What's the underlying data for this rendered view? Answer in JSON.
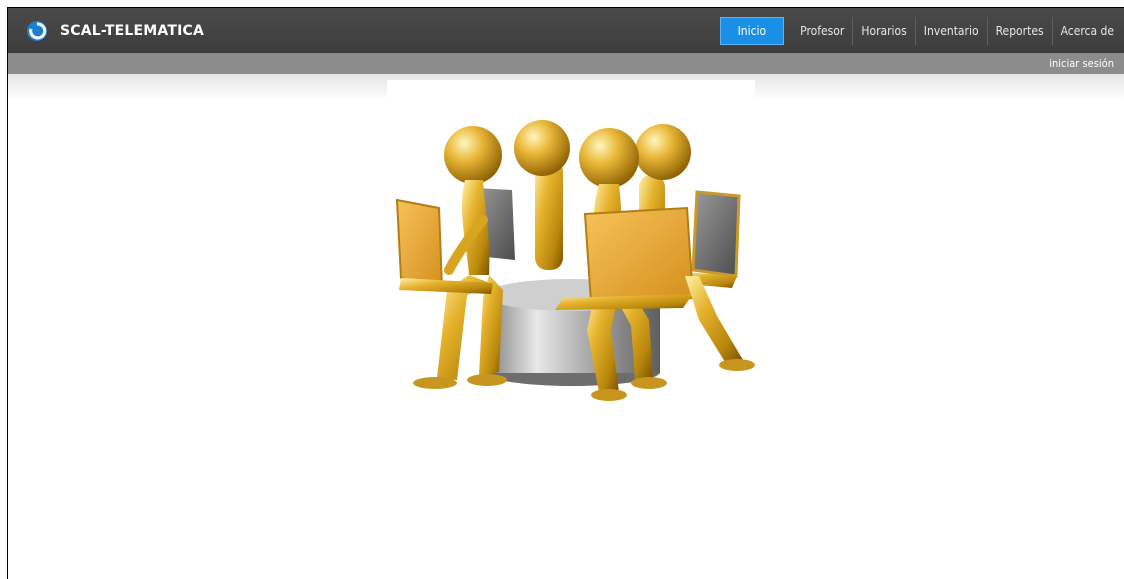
{
  "app": {
    "brand": "SCAL-TELEMATICA"
  },
  "nav": {
    "items": [
      {
        "label": "Inicio",
        "active": true
      },
      {
        "label": "Profesor"
      },
      {
        "label": "Horarios"
      },
      {
        "label": "Inventario"
      },
      {
        "label": "Reportes"
      },
      {
        "label": "Acerca de"
      }
    ]
  },
  "subbar": {
    "login_label": "iniciar sesión"
  },
  "colors": {
    "topbar": "#444444",
    "subbar": "#8c8c8c",
    "active_tab": "#1a8fe8",
    "figure_gold": "#d9a521",
    "cylinder_silver": "#b8b8b8"
  },
  "hero": {
    "icon": "team-computers-illustration"
  }
}
